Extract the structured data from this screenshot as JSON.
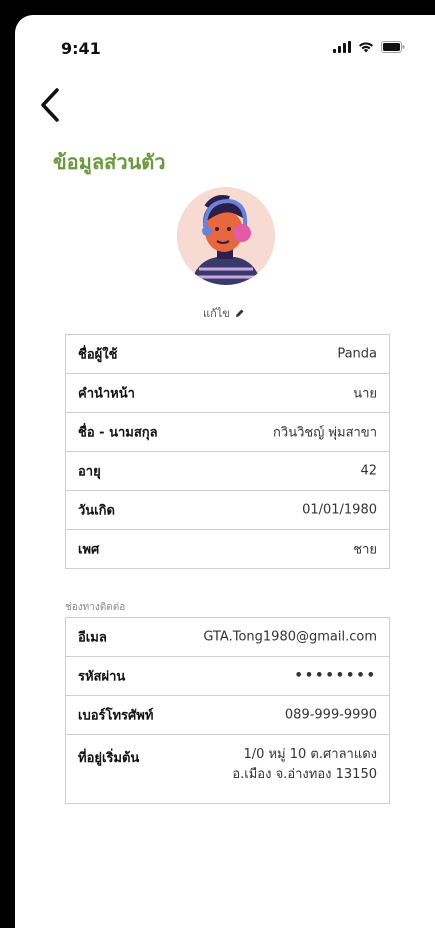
{
  "status_bar": {
    "time": "9:41"
  },
  "page": {
    "title": "ข้อมูลส่วนตัว",
    "edit_label": "แก้ไข"
  },
  "profile": {
    "username_label": "ชื่อผู้ใช้",
    "username": "Panda",
    "prefix_label": "คำนำหน้า",
    "prefix": "นาย",
    "fullname_label": "ชื่อ - นามสกุล",
    "fullname": "กวินวิชญ์ พุ่มสาขา",
    "age_label": "อายุ",
    "age": "42",
    "birthdate_label": "วันเกิด",
    "birthdate": "01/01/1980",
    "gender_label": "เพศ",
    "gender": "ชาย"
  },
  "contact": {
    "section_label": "ช่องทางติดต่อ",
    "email_label": "อีเมล",
    "email": "GTA.Tong1980@gmail.com",
    "password_label": "รหัสผ่าน",
    "password": "••••••••",
    "phone_label": "เบอร์โทรศัพท์",
    "phone": "089-999-9990",
    "address_label": "ที่อยู่เริ่มต้น",
    "address_line1": "1/0 หมู่ 10 ต.ศาลาแดง",
    "address_line2": "อ.เมือง จ.อ่างทอง 13150"
  },
  "colors": {
    "title": "#6a9a3c",
    "avatar_bg": "#f7dbd3"
  },
  "icons": {
    "back": "chevron-left-icon",
    "edit": "pencil-icon"
  }
}
